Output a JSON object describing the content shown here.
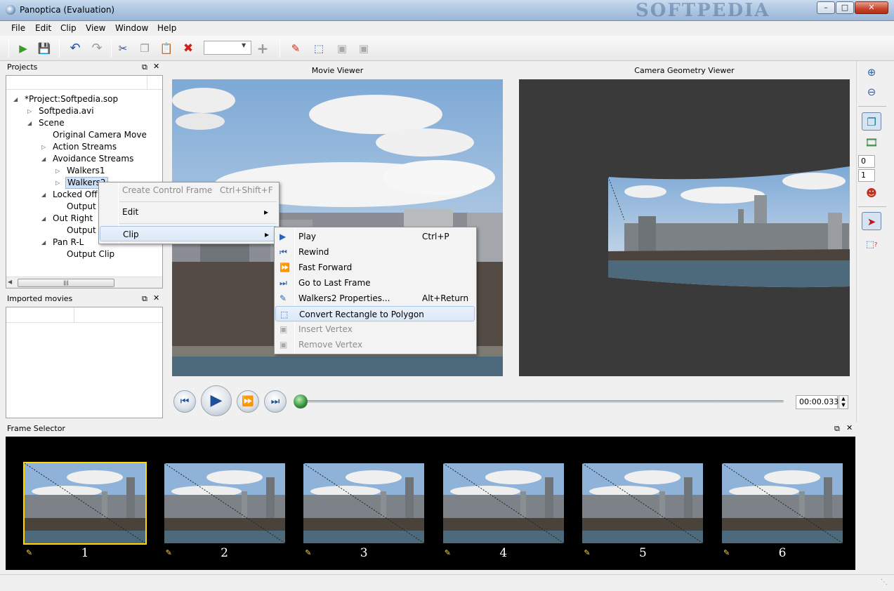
{
  "window": {
    "title": "Panoptica (Evaluation)",
    "watermark": "SOFTPEDIA",
    "min": "–",
    "max": "□",
    "close": "✕"
  },
  "menu": [
    "File",
    "Edit",
    "Clip",
    "View",
    "Window",
    "Help"
  ],
  "toolbar": {
    "zoom_value": ""
  },
  "projects": {
    "title": "Projects",
    "tree": [
      {
        "label": "*Project:Softpedia.sop",
        "level": 0,
        "tri": "◢"
      },
      {
        "label": "Softpedia.avi",
        "level": 1,
        "tri": "▷"
      },
      {
        "label": "Scene",
        "level": 1,
        "tri": "◢"
      },
      {
        "label": "Original Camera Move",
        "level": 2,
        "tri": ""
      },
      {
        "label": "Action Streams",
        "level": 2,
        "tri": "▷"
      },
      {
        "label": "Avoidance Streams",
        "level": 2,
        "tri": "◢"
      },
      {
        "label": "Walkers1",
        "level": 3,
        "tri": "▷"
      },
      {
        "label": "Walkers2",
        "level": 3,
        "tri": "▷"
      },
      {
        "label": "Locked Off",
        "level": 2,
        "tri": "◢"
      },
      {
        "label": "Output C",
        "level": 3,
        "tri": ""
      },
      {
        "label": "Out Right",
        "level": 2,
        "tri": "◢"
      },
      {
        "label": "Output C",
        "level": 3,
        "tri": ""
      },
      {
        "label": "Pan R-L",
        "level": 2,
        "tri": "◢"
      },
      {
        "label": "Output Clip",
        "level": 3,
        "tri": ""
      }
    ]
  },
  "imported": {
    "title": "Imported movies"
  },
  "viewers": {
    "movie": "Movie Viewer",
    "camera": "Camera Geometry Viewer"
  },
  "context_menu": {
    "items": [
      {
        "label": "Create Control Frame",
        "shortcut": "Ctrl+Shift+F",
        "disabled": true
      },
      {
        "label": "Edit",
        "shortcut": "",
        "submenu": true
      },
      {
        "label": "Clip",
        "shortcut": "",
        "submenu": true,
        "highlight": true
      }
    ],
    "submenu_arrow": "▸"
  },
  "clip_menu": {
    "items": [
      {
        "label": "Play",
        "shortcut": "Ctrl+P",
        "icon": "play-icon",
        "glyph": "▶"
      },
      {
        "label": "Rewind",
        "shortcut": "",
        "icon": "rewind-icon",
        "glyph": "⏮"
      },
      {
        "label": "Fast Forward",
        "shortcut": "",
        "icon": "fast-forward-icon",
        "glyph": "⏩"
      },
      {
        "label": "Go to Last Frame",
        "shortcut": "",
        "icon": "last-frame-icon",
        "glyph": "⏭"
      },
      {
        "label": "Walkers2 Properties...",
        "shortcut": "Alt+Return",
        "icon": "properties-icon",
        "glyph": "✎"
      },
      {
        "label": "Convert Rectangle to Polygon",
        "shortcut": "",
        "icon": "convert-polygon-icon",
        "glyph": "⬚",
        "highlight": true
      },
      {
        "label": "Insert Vertex",
        "shortcut": "",
        "icon": "insert-vertex-icon",
        "glyph": "▣",
        "disabled": true
      },
      {
        "label": "Remove Vertex",
        "shortcut": "",
        "icon": "remove-vertex-icon",
        "glyph": "▣",
        "disabled": true
      }
    ]
  },
  "transport": {
    "time": "00:00.033",
    "progress": 0.0
  },
  "frame_selector": {
    "title": "Frame Selector",
    "frames": [
      "1",
      "2",
      "3",
      "4",
      "5",
      "6"
    ],
    "selected": 0
  },
  "right_tools": {
    "spin_a": "0",
    "spin_b": "1"
  },
  "colors": {
    "sky_top": "#8fb6dc",
    "sky_bottom": "#dde6ee",
    "water": "#4f6b7d",
    "accent_select": "#ffd800",
    "viewer_bg": "#3a3a3a"
  }
}
